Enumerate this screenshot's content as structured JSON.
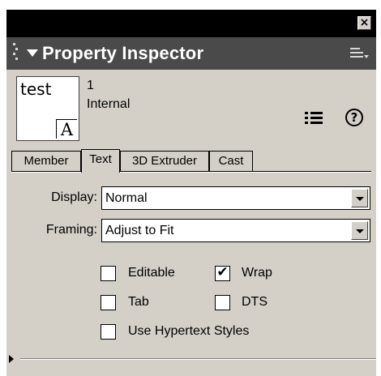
{
  "window": {
    "close_label": "×"
  },
  "inspector": {
    "title": "Property Inspector",
    "header_icons": {
      "collapse": "triangle-down-icon",
      "options_menu": "options-menu-icon",
      "grip": "grip-icon"
    }
  },
  "member": {
    "thumbnail_text": "test",
    "thumbnail_glyph": "A",
    "number": "1",
    "cast_library": "Internal"
  },
  "toolbar": {
    "list_view_icon": "list-view-icon",
    "help_label": "?"
  },
  "tabs": [
    {
      "label": "Member",
      "active": false
    },
    {
      "label": "Text",
      "active": true
    },
    {
      "label": "3D Extruder",
      "active": false
    },
    {
      "label": "Cast",
      "active": false
    }
  ],
  "text_props": {
    "display_label": "Display:",
    "display_value": "Normal",
    "framing_label": "Framing:",
    "framing_value": "Adjust to Fit",
    "checkboxes": [
      {
        "label": "Editable",
        "checked": false
      },
      {
        "label": "Wrap",
        "checked": true
      },
      {
        "label": "Tab",
        "checked": false
      },
      {
        "label": "DTS",
        "checked": false
      },
      {
        "label": "Use Hypertext Styles",
        "checked": false
      }
    ],
    "check_mark": "✔"
  },
  "colors": {
    "titlebar": "#000000",
    "header": "#4a4a4a",
    "panel": "#d4d0c8"
  }
}
